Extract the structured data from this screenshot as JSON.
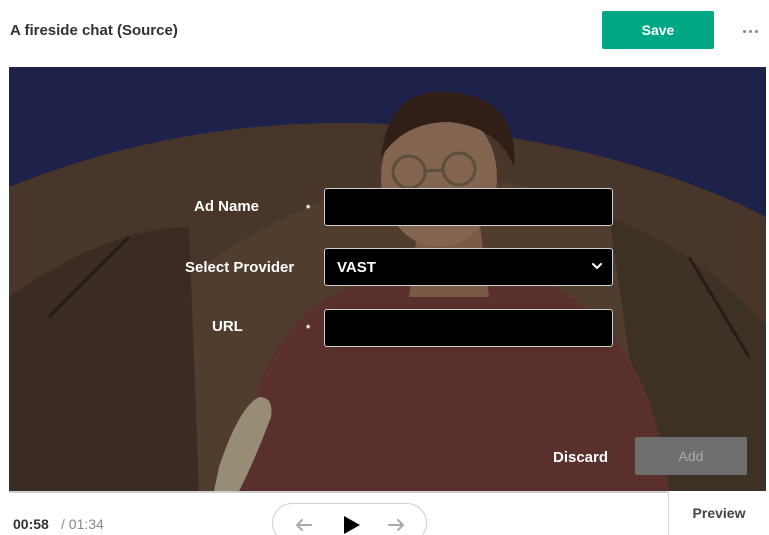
{
  "header": {
    "title": "A fireside chat (Source)",
    "save_label": "Save",
    "more_icon": "more-horizontal-icon"
  },
  "form": {
    "ad_name": {
      "label": "Ad Name",
      "required_mark": "*",
      "value": ""
    },
    "provider": {
      "label": "Select Provider",
      "selected": "VAST"
    },
    "url": {
      "label": "URL",
      "required_mark": "*",
      "value": ""
    },
    "discard_label": "Discard",
    "add_label": "Add"
  },
  "player": {
    "current_time": "00:58",
    "separator": " /",
    "total_time": "01:34",
    "preview_label": "Preview"
  },
  "colors": {
    "accent": "#00a784",
    "add_disabled": "#6e6e6e"
  }
}
